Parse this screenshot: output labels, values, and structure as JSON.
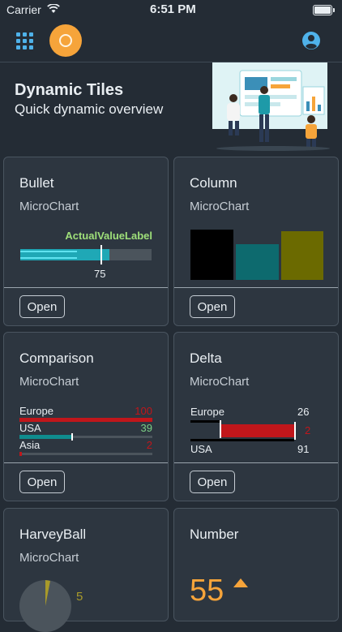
{
  "status_bar": {
    "carrier": "Carrier",
    "time": "6:51 PM"
  },
  "header": {
    "title": "Dynamic Tiles",
    "subtitle": "Quick dynamic overview"
  },
  "tiles": {
    "bullet": {
      "title": "Bullet",
      "subtitle": "MicroChart",
      "actual_label": "ActualValueLabel",
      "value": "75",
      "open": "Open"
    },
    "column": {
      "title": "Column",
      "subtitle": "MicroChart",
      "open": "Open",
      "colors": [
        "#000000",
        "#0d6a6e",
        "#6b6a00"
      ]
    },
    "comparison": {
      "title": "Comparison",
      "subtitle": "MicroChart",
      "open": "Open",
      "rows": [
        {
          "label": "Europe",
          "value": "100",
          "color": "#c0161b"
        },
        {
          "label": "USA",
          "value": "39",
          "color": "#0f8c8e"
        },
        {
          "label": "Asia",
          "value": "2",
          "color": "#c0161b"
        }
      ]
    },
    "delta": {
      "title": "Delta",
      "subtitle": "MicroChart",
      "open": "Open",
      "top_label": "Europe",
      "top_value": "26",
      "delta_value": "2",
      "bottom_label": "USA",
      "bottom_value": "91"
    },
    "harvey": {
      "title": "HarveyBall",
      "subtitle": "MicroChart",
      "value": "5"
    },
    "number": {
      "title": "Number",
      "subtitle": "",
      "value": "55"
    }
  },
  "chart_data": [
    {
      "type": "bar",
      "title": "",
      "series": [
        {
          "values": [
            75
          ]
        }
      ],
      "ylim": [
        0,
        100
      ]
    },
    {
      "type": "bar",
      "categories": [
        "",
        "",
        ""
      ],
      "values": [
        62,
        44,
        60
      ]
    },
    {
      "type": "bar",
      "categories": [
        "Europe",
        "USA",
        "Asia"
      ],
      "values": [
        100,
        39,
        2
      ],
      "ylim": [
        0,
        100
      ]
    },
    {
      "type": "bar",
      "categories": [
        "Europe",
        "USA"
      ],
      "values": [
        26,
        91
      ],
      "delta": 2
    }
  ]
}
